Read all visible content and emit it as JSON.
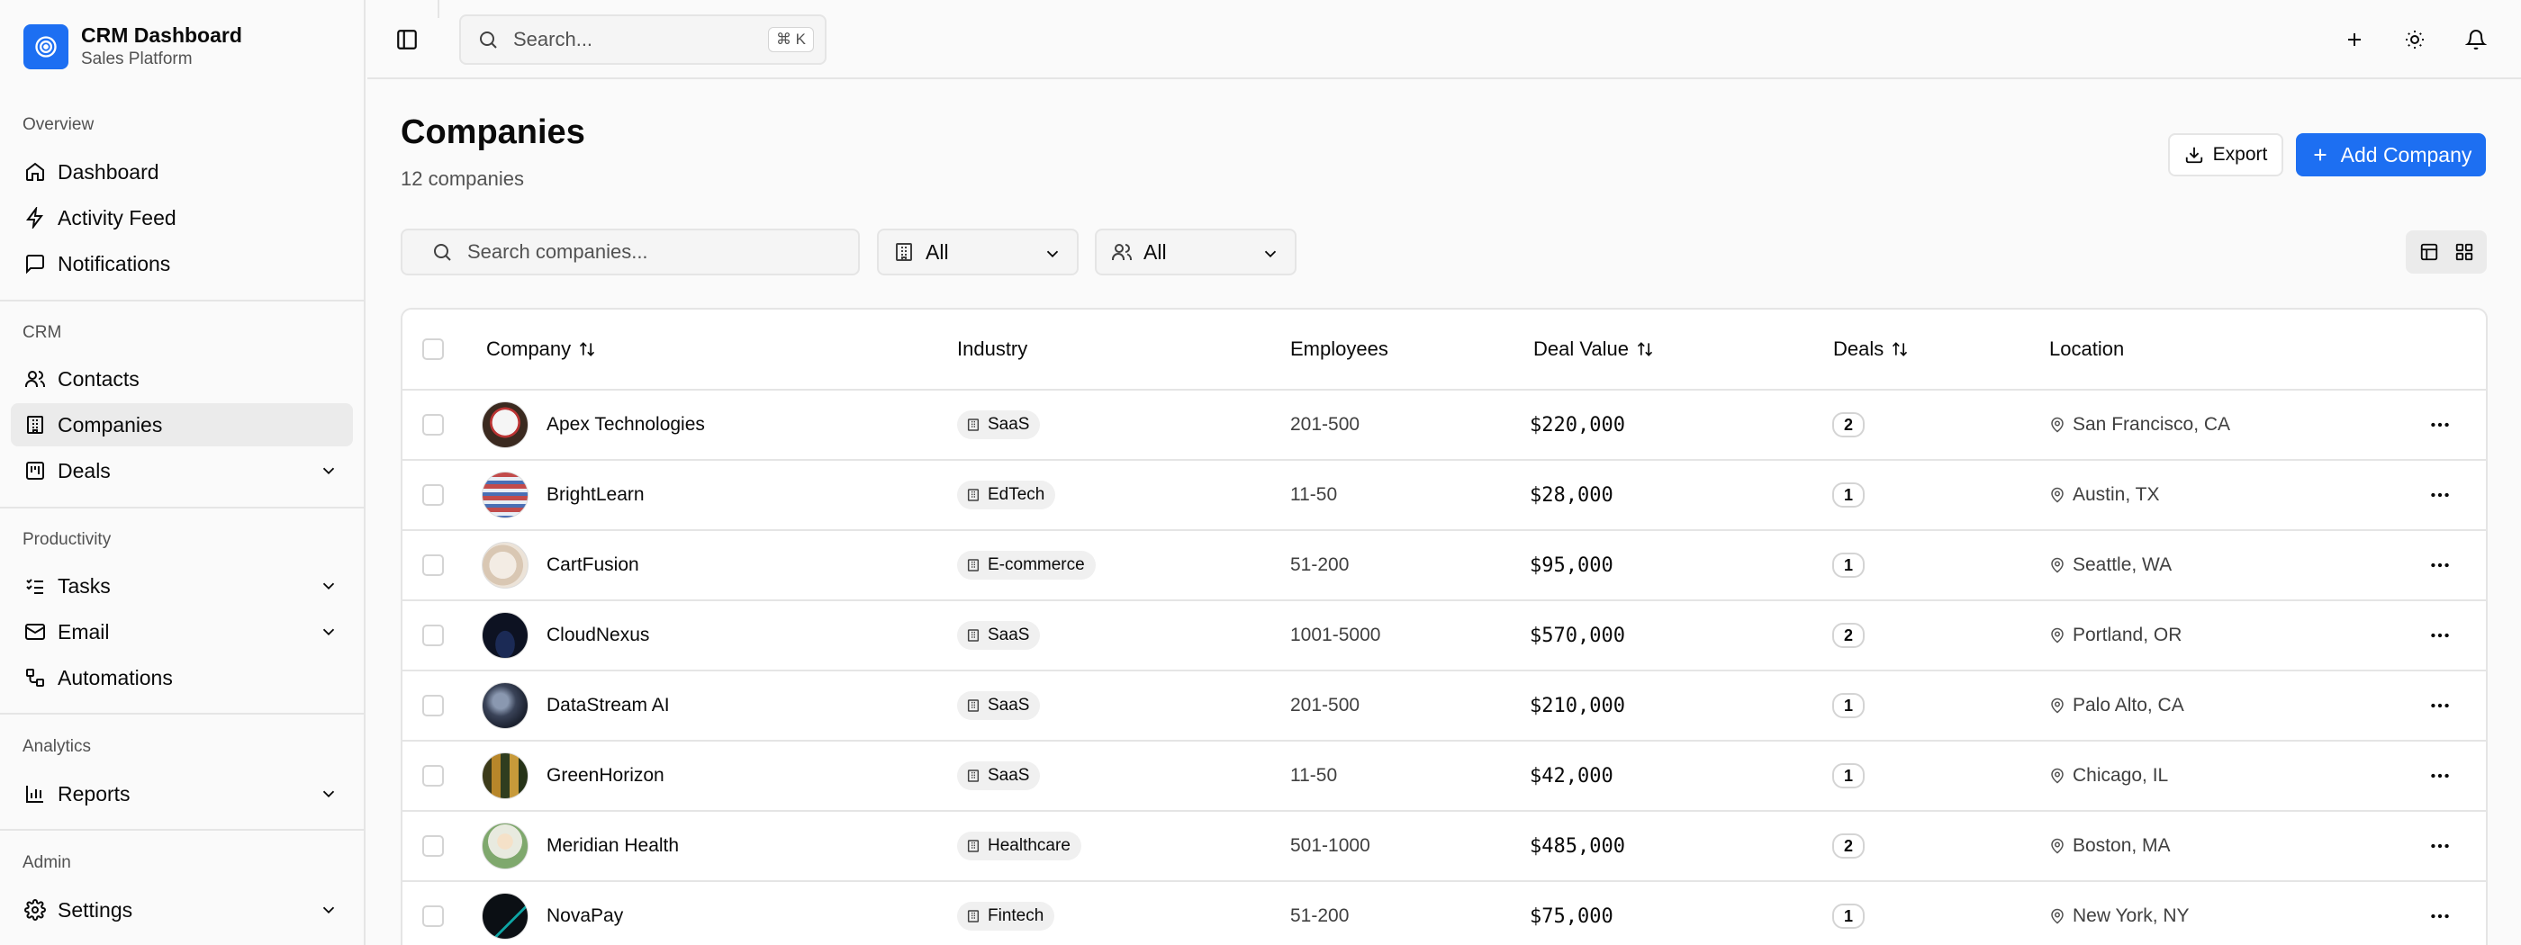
{
  "app": {
    "title": "CRM Dashboard",
    "subtitle": "Sales Platform"
  },
  "sidebar": {
    "sections": [
      {
        "label": "Overview"
      },
      {
        "label": "CRM"
      },
      {
        "label": "Productivity"
      },
      {
        "label": "Analytics"
      },
      {
        "label": "Admin"
      }
    ],
    "items": [
      {
        "label": "Dashboard",
        "icon": "home-icon"
      },
      {
        "label": "Activity Feed",
        "icon": "zap-icon"
      },
      {
        "label": "Notifications",
        "icon": "message-icon"
      },
      {
        "label": "Contacts",
        "icon": "users-icon"
      },
      {
        "label": "Companies",
        "icon": "building-icon",
        "active": true
      },
      {
        "label": "Deals",
        "icon": "kanban-icon",
        "expandable": true
      },
      {
        "label": "Tasks",
        "icon": "list-checks-icon",
        "expandable": true
      },
      {
        "label": "Email",
        "icon": "mail-icon",
        "expandable": true
      },
      {
        "label": "Automations",
        "icon": "workflow-icon"
      },
      {
        "label": "Reports",
        "icon": "bar-chart-icon",
        "expandable": true
      },
      {
        "label": "Settings",
        "icon": "gear-icon",
        "expandable": true
      }
    ]
  },
  "topbar": {
    "search_placeholder": "Search...",
    "shortcut": "⌘ K"
  },
  "page": {
    "title": "Companies",
    "subtitle": "12 companies",
    "export_label": "Export",
    "add_label": "Add Company"
  },
  "filters": {
    "search_placeholder": "Search companies...",
    "industry_value": "All",
    "size_value": "All"
  },
  "table": {
    "headers": {
      "company": "Company",
      "industry": "Industry",
      "employees": "Employees",
      "deal_value": "Deal Value",
      "deals": "Deals",
      "location": "Location"
    },
    "rows": [
      {
        "name": "Apex Technologies",
        "industry": "SaaS",
        "employees": "201-500",
        "deal_value": "$220,000",
        "deals": "2",
        "location": "San Francisco, CA"
      },
      {
        "name": "BrightLearn",
        "industry": "EdTech",
        "employees": "11-50",
        "deal_value": "$28,000",
        "deals": "1",
        "location": "Austin, TX"
      },
      {
        "name": "CartFusion",
        "industry": "E-commerce",
        "employees": "51-200",
        "deal_value": "$95,000",
        "deals": "1",
        "location": "Seattle, WA"
      },
      {
        "name": "CloudNexus",
        "industry": "SaaS",
        "employees": "1001-5000",
        "deal_value": "$570,000",
        "deals": "2",
        "location": "Portland, OR"
      },
      {
        "name": "DataStream AI",
        "industry": "SaaS",
        "employees": "201-500",
        "deal_value": "$210,000",
        "deals": "1",
        "location": "Palo Alto, CA"
      },
      {
        "name": "GreenHorizon",
        "industry": "SaaS",
        "employees": "11-50",
        "deal_value": "$42,000",
        "deals": "1",
        "location": "Chicago, IL"
      },
      {
        "name": "Meridian Health",
        "industry": "Healthcare",
        "employees": "501-1000",
        "deal_value": "$485,000",
        "deals": "2",
        "location": "Boston, MA"
      },
      {
        "name": "NovaPay",
        "industry": "Fintech",
        "employees": "51-200",
        "deal_value": "$75,000",
        "deals": "1",
        "location": "New York, NY"
      }
    ]
  },
  "colors": {
    "accent": "#1d6ff2",
    "border": "#e5e5e5",
    "active_bg": "#ebebeb"
  }
}
